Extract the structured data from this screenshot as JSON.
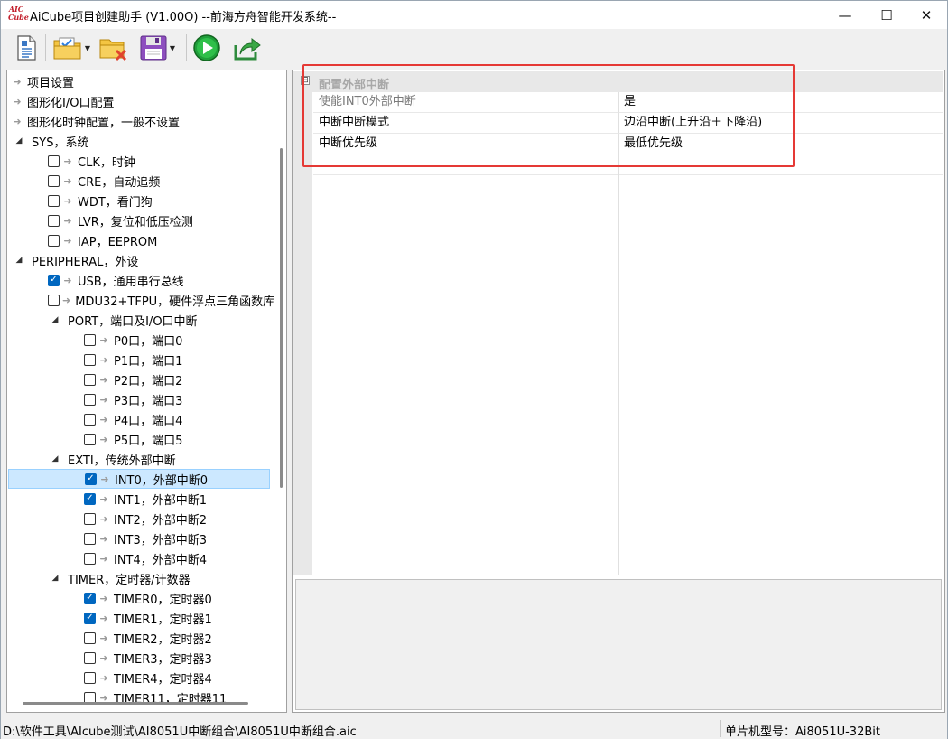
{
  "window": {
    "title": "AiCube项目创建助手 (V1.00O) --前海方舟智能开发系统--",
    "icon_text_top": "AIC",
    "icon_text_bottom": "Cube",
    "minimize_glyph": "—",
    "maximize_glyph": "☐",
    "close_glyph": "✕"
  },
  "toolbar": {
    "buttons": [
      {
        "name": "new-document-icon"
      },
      {
        "name": "open-folder-icon",
        "has_dropdown": true
      },
      {
        "name": "close-folder-icon"
      },
      {
        "name": "save-disk-icon",
        "has_dropdown": true
      },
      {
        "name": "run-play-icon"
      },
      {
        "name": "export-share-icon"
      }
    ]
  },
  "tree": {
    "items": [
      {
        "label": "项目设置",
        "level": 0,
        "kind": "arrow"
      },
      {
        "label": "图形化I/O口配置",
        "level": 0,
        "kind": "arrow"
      },
      {
        "label": "图形化时钟配置，一般不设置",
        "level": 0,
        "kind": "arrow"
      },
      {
        "label": "SYS，系统",
        "level": 0,
        "kind": "expanded"
      },
      {
        "label": "CLK，时钟",
        "level": 1,
        "kind": "check",
        "checked": false
      },
      {
        "label": "CRE，自动追频",
        "level": 1,
        "kind": "check",
        "checked": false
      },
      {
        "label": "WDT，看门狗",
        "level": 1,
        "kind": "check",
        "checked": false
      },
      {
        "label": "LVR，复位和低压检测",
        "level": 1,
        "kind": "check",
        "checked": false
      },
      {
        "label": "IAP，EEPROM",
        "level": 1,
        "kind": "check",
        "checked": false
      },
      {
        "label": "PERIPHERAL，外设",
        "level": 0,
        "kind": "expanded"
      },
      {
        "label": "USB，通用串行总线",
        "level": 1,
        "kind": "check",
        "checked": true
      },
      {
        "label": "MDU32+TFPU，硬件浮点三角函数库",
        "level": 1,
        "kind": "check",
        "checked": false
      },
      {
        "label": "PORT，端口及I/O口中断",
        "level": 1,
        "kind": "expanded"
      },
      {
        "label": "P0口，端口0",
        "level": 2,
        "kind": "check",
        "checked": false
      },
      {
        "label": "P1口，端口1",
        "level": 2,
        "kind": "check",
        "checked": false
      },
      {
        "label": "P2口，端口2",
        "level": 2,
        "kind": "check",
        "checked": false
      },
      {
        "label": "P3口，端口3",
        "level": 2,
        "kind": "check",
        "checked": false
      },
      {
        "label": "P4口，端口4",
        "level": 2,
        "kind": "check",
        "checked": false
      },
      {
        "label": "P5口，端口5",
        "level": 2,
        "kind": "check",
        "checked": false
      },
      {
        "label": "EXTI，传统外部中断",
        "level": 1,
        "kind": "expanded"
      },
      {
        "label": "INT0，外部中断0",
        "level": 2,
        "kind": "check",
        "checked": true,
        "selected": true
      },
      {
        "label": "INT1，外部中断1",
        "level": 2,
        "kind": "check",
        "checked": true
      },
      {
        "label": "INT2，外部中断2",
        "level": 2,
        "kind": "check",
        "checked": false
      },
      {
        "label": "INT3，外部中断3",
        "level": 2,
        "kind": "check",
        "checked": false
      },
      {
        "label": "INT4，外部中断4",
        "level": 2,
        "kind": "check",
        "checked": false
      },
      {
        "label": "TIMER，定时器/计数器",
        "level": 1,
        "kind": "expanded"
      },
      {
        "label": "TIMER0，定时器0",
        "level": 2,
        "kind": "check",
        "checked": true
      },
      {
        "label": "TIMER1，定时器1",
        "level": 2,
        "kind": "check",
        "checked": true
      },
      {
        "label": "TIMER2，定时器2",
        "level": 2,
        "kind": "check",
        "checked": false
      },
      {
        "label": "TIMER3，定时器3",
        "level": 2,
        "kind": "check",
        "checked": false
      },
      {
        "label": "TIMER4，定时器4",
        "level": 2,
        "kind": "check",
        "checked": false
      },
      {
        "label": "TIMER11，定时器11",
        "level": 2,
        "kind": "check",
        "checked": false
      }
    ]
  },
  "property_grid": {
    "category_title": "配置外部中断",
    "collapse_glyph": "⊟",
    "rows": [
      {
        "name": "使能INT0外部中断",
        "value": "是",
        "dimmed": true
      },
      {
        "name": "中断中断模式",
        "value": "边沿中断(上升沿＋下降沿)"
      },
      {
        "name": "中断优先级",
        "value": "最低优先级"
      },
      {
        "name": "",
        "value": ""
      }
    ]
  },
  "status": {
    "path": "D:\\软件工具\\AIcube测试\\AI8051U中断组合\\AI8051U中断组合.aic",
    "model": "单片机型号：Ai8051U-32Bit"
  },
  "colors": {
    "highlight_box": "#e53935",
    "selection": "#cce8ff",
    "checkbox_checked": "#0067c0"
  }
}
